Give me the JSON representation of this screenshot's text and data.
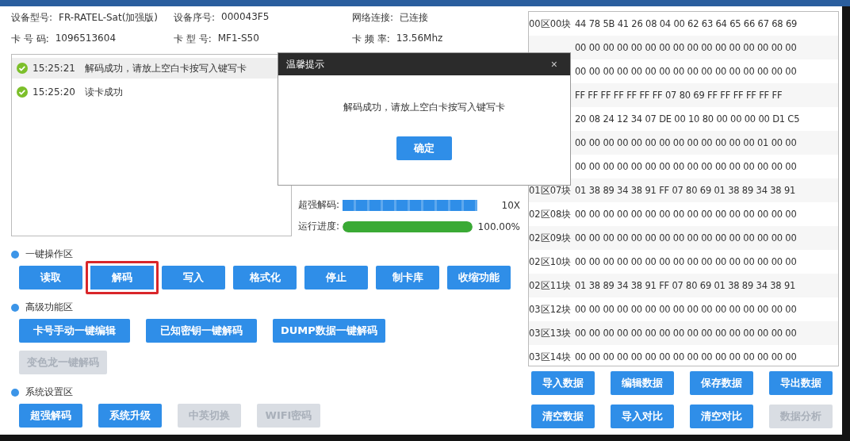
{
  "device_info": [
    {
      "label": "设备型号:",
      "value": "FR-RATEL-Sat(加强版)"
    },
    {
      "label": "设备序号:",
      "value": "000043F5"
    },
    {
      "label": "网络连接:",
      "value": "已连接"
    },
    {
      "label": "卡 号 码:",
      "value": "1096513604"
    },
    {
      "label": "卡 型 号:",
      "value": "MF1-S50"
    },
    {
      "label": "卡 频 率:",
      "value": "13.56Mhz"
    }
  ],
  "log": [
    {
      "time": "15:25:21",
      "message": "解码成功，请放上空白卡按写入键写卡",
      "selected": true
    },
    {
      "time": "15:25:20",
      "message": "读卡成功",
      "selected": false
    }
  ],
  "meters": [
    {
      "kind": "segments",
      "label": "超强解码:",
      "level": 1,
      "reading": "10X"
    },
    {
      "kind": "bar",
      "label": "运行进度:",
      "level": 1,
      "reading": "100.00%"
    }
  ],
  "sections": [
    {
      "title": "一键操作区",
      "buttons": [
        {
          "label": "读取",
          "disabled": false,
          "highlighted": false
        },
        {
          "label": "解码",
          "disabled": false,
          "highlighted": true
        },
        {
          "label": "写入",
          "disabled": false,
          "highlighted": false
        },
        {
          "label": "格式化",
          "disabled": false,
          "highlighted": false
        },
        {
          "label": "停止",
          "disabled": false,
          "highlighted": false
        },
        {
          "label": "制卡库",
          "disabled": false,
          "highlighted": false
        },
        {
          "label": "收缩功能",
          "disabled": false,
          "highlighted": false
        }
      ]
    },
    {
      "title": "高级功能区",
      "buttons": [
        {
          "label": "卡号手动一键编辑",
          "disabled": false,
          "highlighted": false
        },
        {
          "label": "已知密钥一键解码",
          "disabled": false,
          "highlighted": false
        },
        {
          "label": "DUMP数据一键解码",
          "disabled": false,
          "highlighted": false
        },
        {
          "label": "变色龙一键解码",
          "disabled": true,
          "highlighted": false
        }
      ]
    },
    {
      "title": "系统设置区",
      "buttons": [
        {
          "label": "超强解码",
          "disabled": false,
          "highlighted": false
        },
        {
          "label": "系统升级",
          "disabled": false,
          "highlighted": false
        },
        {
          "label": "中英切换",
          "disabled": true,
          "highlighted": false
        },
        {
          "label": "WIFI密码",
          "disabled": true,
          "highlighted": false
        }
      ]
    }
  ],
  "hex_dump": [
    {
      "block": "00区00块",
      "bytes": "44 78 5B 41 26 08 04 00 62 63 64 65 66 67 68 69"
    },
    {
      "bytes": "00 00 00 00 00 00 00 00 00 00 00 00 00 00 00 00"
    },
    {
      "bytes": "00 00 00 00 00 00 00 00 00 00 00 00 00 00 00 00"
    },
    {
      "bytes": "FF FF FF FF FF FF FF 07 80 69 FF FF FF FF FF FF"
    },
    {
      "bytes": "20 08 24 12 34 07 DE 00 10 80 00 00 00 00 D1 C5"
    },
    {
      "bytes": "00 00 00 00 00 00 00 00 00 00 00 00 00 01 00 00"
    },
    {
      "bytes": "00 00 00 00 00 00 00 00 00 00 00 00 00 00 00 00"
    },
    {
      "block": "01区07块",
      "bytes": "01 38 89 34 38 91 FF 07 80 69 01 38 89 34 38 91"
    },
    {
      "block": "02区08块",
      "bytes": "00 00 00 00 00 00 00 00 00 00 00 00 00 00 00 00"
    },
    {
      "block": "02区09块",
      "bytes": "00 00 00 00 00 00 00 00 00 00 00 00 00 00 00 00"
    },
    {
      "block": "02区10块",
      "bytes": "00 00 00 00 00 00 00 00 00 00 00 00 00 00 00 00"
    },
    {
      "block": "02区11块",
      "bytes": "01 38 89 34 38 91 FF 07 80 69 01 38 89 34 38 91"
    },
    {
      "block": "03区12块",
      "bytes": "00 00 00 00 00 00 00 00 00 00 00 00 00 00 00 00"
    },
    {
      "block": "03区13块",
      "bytes": "00 00 00 00 00 00 00 00 00 00 00 00 00 00 00 00"
    },
    {
      "block": "03区14块",
      "bytes": "00 00 00 00 00 00 00 00 00 00 00 00 00 00 00 00"
    }
  ],
  "data_buttons": [
    {
      "label": "导入数据",
      "disabled": false
    },
    {
      "label": "编辑数据",
      "disabled": false
    },
    {
      "label": "保存数据",
      "disabled": false
    },
    {
      "label": "导出数据",
      "disabled": false
    },
    {
      "label": "清空数据",
      "disabled": false
    },
    {
      "label": "导入对比",
      "disabled": false
    },
    {
      "label": "清空对比",
      "disabled": false
    },
    {
      "label": "数据分析",
      "disabled": true
    }
  ],
  "dialog": {
    "title": "温馨提示",
    "close": "×",
    "message": "解码成功，请放上空白卡按写入键写卡",
    "ok": "确定"
  }
}
